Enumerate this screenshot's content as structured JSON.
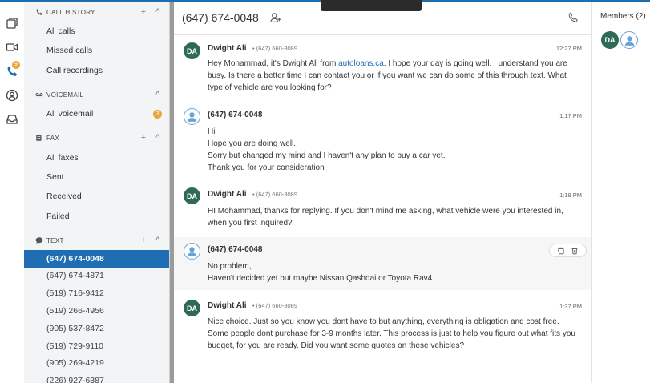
{
  "colors": {
    "accent": "#1f6db3",
    "badge": "#e8a33a",
    "avatar_green": "#2e6a55"
  },
  "rail": {
    "icons": [
      "chat-windows-icon",
      "video-icon",
      "phone-icon",
      "contact-icon",
      "inbox-icon"
    ],
    "phone_badge": "9"
  },
  "sidebar": {
    "call_history": {
      "title": "CALL HISTORY",
      "items": [
        "All calls",
        "Missed calls",
        "Call recordings"
      ]
    },
    "voicemail": {
      "title": "VOICEMAIL",
      "items": [
        "All voicemail"
      ],
      "badge": "3"
    },
    "fax": {
      "title": "FAX",
      "items": [
        "All faxes",
        "Sent",
        "Received",
        "Failed"
      ]
    },
    "text": {
      "title": "TEXT",
      "items": [
        "(647) 674-0048",
        "(647) 674-4871",
        "(519) 716-9412",
        "(519) 266-4956",
        "(905) 537-8472",
        "(519) 729-9110",
        "(905) 269-4219",
        "(226) 927-6387"
      ]
    },
    "add_symbol": "+",
    "collapse_symbol": "^"
  },
  "conversation": {
    "title": "(647) 674-0048"
  },
  "messages": [
    {
      "avatar": "DA",
      "name": "Dwight Ali",
      "sub": "• (647) 660-3089",
      "time": "12:27 PM",
      "body_pre": "Hey Mohammad, it's Dwight Ali from ",
      "body_link": "autoloans.ca",
      "body_post": ".  I hope your day is going well.  I understand you are busy.  Is there a better time I can contact you or if you want we can do some of this through text.  What type of vehicle are you looking for?"
    },
    {
      "avatar": "",
      "name": "(647) 674-0048",
      "sub": "",
      "time": "1:17 PM",
      "lines": [
        "Hi",
        "Hope you are doing well.",
        "Sorry but changed my mind and I haven't any plan to buy a car yet.",
        "Thank you for your consideration"
      ]
    },
    {
      "avatar": "DA",
      "name": "Dwight Ali",
      "sub": "• (647) 660-3089",
      "time": "1:18 PM",
      "body": "HI Mohammad, thanks for replying.  If you don't mind me asking, what vehicle were you interested in, when you first inquired?"
    },
    {
      "avatar": "",
      "name": "(647) 674-0048",
      "sub": "",
      "time": "",
      "lines": [
        "No problem,",
        "Haven't decided yet but maybe Nissan Qashqai or Toyota Rav4"
      ]
    },
    {
      "avatar": "DA",
      "name": "Dwight Ali",
      "sub": "• (647) 660-3089",
      "time": "1:37 PM",
      "body": "Nice choice.  Just so you know you dont have to but anything, everything is obligation and cost free.  Some people dont purchase for 3-9 months later. This process is just to help you figure out what fits you budget, for you are ready.  Did you want some quotes on these vehicles?"
    }
  ],
  "members": {
    "title": "Members (2)",
    "avatars": [
      "DA",
      ""
    ]
  }
}
